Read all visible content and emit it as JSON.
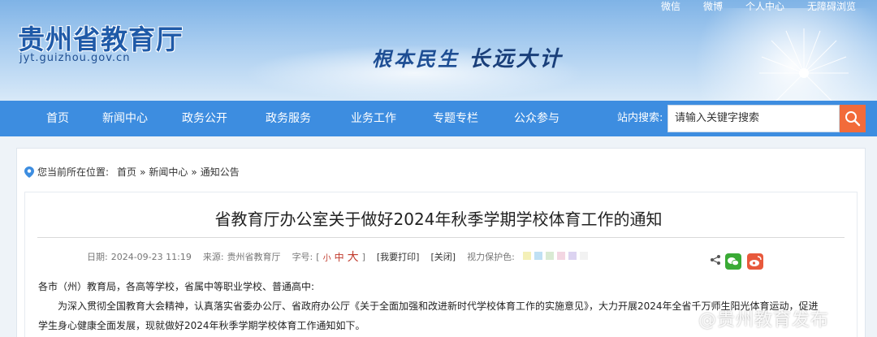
{
  "header": {
    "title": "贵州省教育厅",
    "domain": "jyt.guizhou.gov.cn",
    "slogan_a": "根本民生",
    "slogan_b": "长远大计",
    "toplinks": [
      "微信",
      "微博",
      "个人中心",
      "无障碍浏览"
    ]
  },
  "nav": {
    "items": [
      "首页",
      "新闻中心",
      "政务公开",
      "政务服务",
      "业务工作",
      "专题专栏",
      "公众参与"
    ],
    "search_label": "站内搜索:",
    "search_placeholder": "请输入关键字搜索"
  },
  "breadcrumb": {
    "prefix": "您当前所在位置:",
    "items": [
      "首页",
      "新闻中心",
      "通知公告"
    ],
    "separator": "»"
  },
  "article": {
    "title": "省教育厅办公室关于做好2024年秋季学期学校体育工作的通知",
    "date_label": "日期:",
    "date": "2024-09-23 11:19",
    "source_label": "来源:",
    "source": "贵州省教育厅",
    "fontsize_label": "字号:",
    "fontsize_open": "[",
    "fontsize_small": "小",
    "fontsize_mid": "中",
    "fontsize_big": "大",
    "fontsize_close": "]",
    "print": "[我要打印]",
    "close": "[关闭]",
    "eye_label": "视力保护色:",
    "eye_colors": [
      "#f4f0b8",
      "#bfe0f4",
      "#d9ead3",
      "#f3d6e2",
      "#dcd3f1",
      "#f2f2f2"
    ],
    "salutation": "各市（州）教育局，各高等学校，省属中等职业学校、普通高中:",
    "para1": "为深入贯彻全国教育大会精神，认真落实省委办公厅、省政府办公厅《关于全面加强和改进新时代学校体育工作的实施意见》，大力开展2024年全省千万师生阳光体育运动，促进",
    "para2": "学生身心健康全面发展，现就做好2024年秋季学期学校体育工作通知如下。"
  },
  "watermark": "@贵州教育发布"
}
